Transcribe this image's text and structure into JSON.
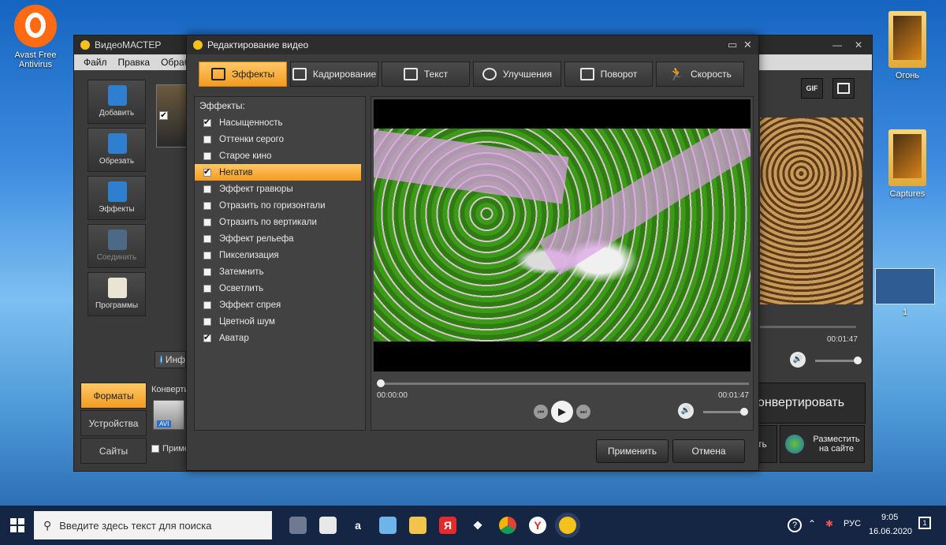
{
  "desktop": {
    "icons": [
      {
        "label": "Avast Free Antivirus"
      },
      {
        "label": "Огонь"
      },
      {
        "label": "Captures"
      },
      {
        "label": "1"
      }
    ]
  },
  "main_window": {
    "title": "ВидеоМАСТЕР",
    "menu": [
      "Файл",
      "Правка",
      "Обрабо"
    ],
    "tools": [
      "Добавить",
      "Обрезать",
      "Эффекты",
      "Соединить",
      "Программы"
    ],
    "info_tab": "Инф",
    "side_tabs": [
      "Форматы",
      "Устройства",
      "Сайты"
    ],
    "convert_label": "Конверти",
    "format_badge": "AVI",
    "apply_checkbox": "Приме",
    "gif_label": "GIF",
    "time_end": "00:01:47",
    "convert_button": "онвертировать",
    "partial_button": "ть",
    "publish_button": "Разместить на сайте"
  },
  "dialog": {
    "title": "Редактирование видео",
    "tabs": [
      {
        "label": "Эффекты",
        "active": true
      },
      {
        "label": "Кадрирование",
        "active": false
      },
      {
        "label": "Текст",
        "active": false
      },
      {
        "label": "Улучшения",
        "active": false
      },
      {
        "label": "Поворот",
        "active": false
      },
      {
        "label": "Скорость",
        "active": false
      }
    ],
    "effects_header": "Эффекты:",
    "effects": [
      {
        "label": "Насыщенность",
        "checked": true,
        "selected": false
      },
      {
        "label": "Оттенки серого",
        "checked": false,
        "selected": false
      },
      {
        "label": "Старое кино",
        "checked": false,
        "selected": false
      },
      {
        "label": "Негатив",
        "checked": true,
        "selected": true
      },
      {
        "label": "Эффект гравюры",
        "checked": false,
        "selected": false
      },
      {
        "label": "Отразить по горизонтали",
        "checked": false,
        "selected": false
      },
      {
        "label": "Отразить по вертикали",
        "checked": false,
        "selected": false
      },
      {
        "label": "Эффект рельефа",
        "checked": false,
        "selected": false
      },
      {
        "label": "Пикселизация",
        "checked": false,
        "selected": false
      },
      {
        "label": "Затемнить",
        "checked": false,
        "selected": false
      },
      {
        "label": "Осветлить",
        "checked": false,
        "selected": false
      },
      {
        "label": "Эффект спрея",
        "checked": false,
        "selected": false
      },
      {
        "label": "Цветной шум",
        "checked": false,
        "selected": false
      },
      {
        "label": "Аватар",
        "checked": true,
        "selected": false
      }
    ],
    "time_start": "00:00:00",
    "time_end": "00:01:47",
    "apply_button": "Применить",
    "cancel_button": "Отмена",
    "playback_progress": 0.0,
    "volume_level": 1.0
  },
  "taskbar": {
    "search_placeholder": "Введите здесь текст для поиска",
    "language": "РУС",
    "time": "9:05",
    "date": "16.06.2020",
    "notification_count": "1"
  },
  "colors": {
    "accent": "#f39c21",
    "panel": "#3c3c3c",
    "taskbar": "#152544"
  }
}
